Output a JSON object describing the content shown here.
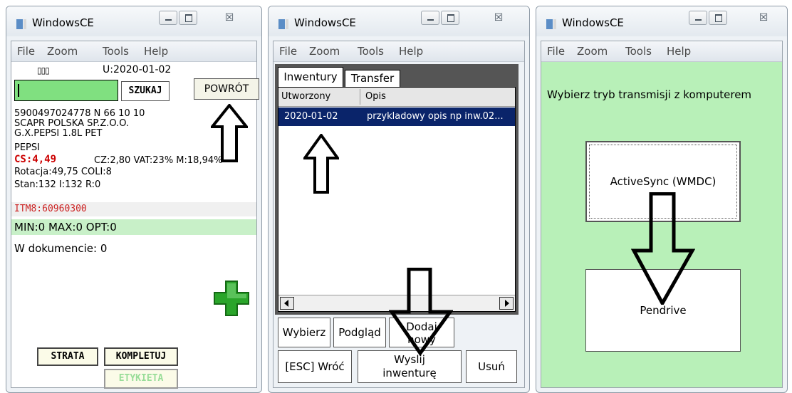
{
  "window": {
    "title": "WindowsCE",
    "close_glyph": "☒"
  },
  "menu": {
    "file": "File",
    "zoom": "Zoom",
    "tools": "Tools",
    "help": "Help"
  },
  "panel1": {
    "barcode_glyph": "▯▯▯",
    "date": "U:2020-01-02",
    "search_input_value": "",
    "search_button": "SZUKAJ",
    "back_button": "POWRÓT",
    "line1": "5900497024778  N  66 10 10",
    "line2": "SCAPR POLSKA SP.Z.O.O.",
    "line3": "G.X.PEPSI 1.8L PET",
    "line4": "PEPSI",
    "price": "CS:4,49",
    "price_details": "CZ:2,80  VAT:23%  M:18,94%",
    "rotation": "Rotacja:49,75  COLI:8",
    "stock": "Stan:132  I:132  R:0",
    "itm": "ITM8:60960300",
    "minmax": "MIN:0  MAX:0  OPT:0",
    "in_document": "W dokumencie: 0",
    "strata_button": "STRATA",
    "kompletuj_button": "KOMPLETUJ",
    "etykieta_button": "ETYKIETA"
  },
  "panel2": {
    "tabs": [
      "Inwentury",
      "Transfer"
    ],
    "columns": [
      "Utworzony",
      "Opis"
    ],
    "rows": [
      {
        "created": "2020-01-02",
        "description": "przykladowy opis np inw.02..."
      }
    ],
    "buttons": {
      "wybierz": "Wybierz",
      "podglad": "Podgląd",
      "dodaj_1": "Dodaj",
      "dodaj_2": "nowy",
      "esc": "[ESC] Wróć",
      "wyslij_1": "Wyslij",
      "wyslij_2": "inwenturę",
      "usun": "Usuń"
    }
  },
  "panel3": {
    "prompt": "Wybierz tryb transmisji z komputerem",
    "activesync_button": "ActiveSync (WMDC)",
    "pendrive_button": "Pendrive"
  },
  "colors": {
    "accent_green": "#80e080",
    "panel3_bg": "#b8f0b8",
    "selection": "#0a246a",
    "price_red": "#cc0000",
    "plus_green": "#2aa52a"
  }
}
